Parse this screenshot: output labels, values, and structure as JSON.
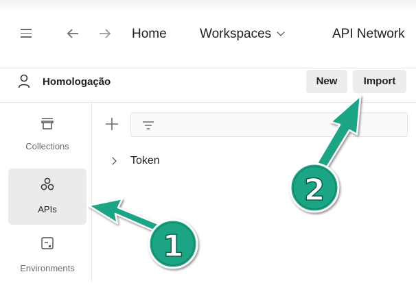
{
  "nav": {
    "home_label": "Home",
    "workspaces_label": "Workspaces",
    "api_network_label": "API Network"
  },
  "workspace": {
    "name": "Homologação",
    "new_label": "New",
    "import_label": "Import"
  },
  "sidebar": {
    "items": [
      {
        "label": "Collections",
        "icon": "collections-icon"
      },
      {
        "label": "APIs",
        "icon": "apis-icon",
        "active": true
      },
      {
        "label": "Environments",
        "icon": "environments-icon"
      }
    ]
  },
  "tree": {
    "items": [
      {
        "label": "Token"
      }
    ]
  },
  "annotations": {
    "step1": "1",
    "step2": "2",
    "color": "#1f9e82"
  }
}
